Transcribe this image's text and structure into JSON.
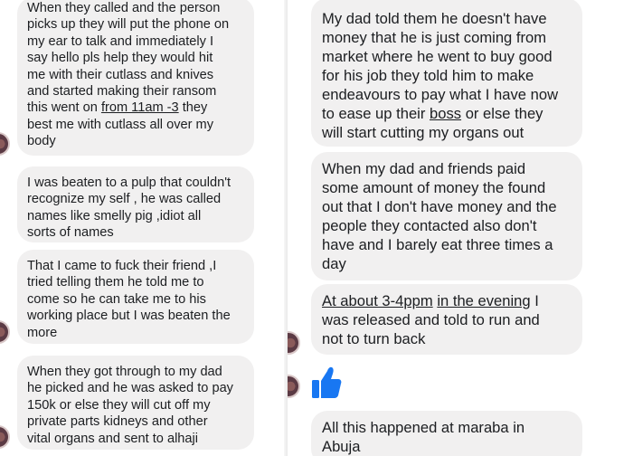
{
  "left_column": {
    "messages": [
      {
        "lines": [
          "When they called and the person",
          "picks up they will put the phone on",
          "my ear to talk and immediately I",
          "say hello pls help they would hit",
          "me with their cutlass and knives",
          "and started making their ransom"
        ],
        "line7_before": "this went on ",
        "line7_link": "from 11am -3",
        "line7_after": " they",
        "lines_end": [
          "best me with cutlass all over my",
          "body"
        ]
      },
      {
        "lines": [
          "I was beaten to a pulp that couldn't",
          "recognize my self , he was called",
          "names like smelly pig ,idiot all",
          "sorts of names"
        ]
      },
      {
        "lines": [
          "That I came to fuck their friend ,I",
          "tried telling them he told me to",
          "come so he can take me to his",
          "working place but I was beaten the",
          "more"
        ]
      },
      {
        "lines": [
          "When they got through to my dad",
          "he picked and he was asked to pay",
          "150k or else they will cut off my",
          "private parts kidneys and other",
          "vital organs and sent to alhaji"
        ]
      }
    ]
  },
  "right_column": {
    "messages": [
      {
        "lines": [
          "My dad told them he doesn't have",
          "money that he is just coming from",
          "market where he went to buy good",
          "for his job they told him to make",
          "endeavours to pay what I have now"
        ],
        "line6_before": "to ease up their ",
        "line6_link": "boss",
        "line6_after": " or else they",
        "lines_end": [
          "will start cutting my organs out"
        ]
      },
      {
        "lines": [
          "When my dad and friends paid",
          "some amount of money the found",
          "out that I don't have money and the",
          "people they contacted also don't",
          "have and I barely eat three times a",
          "day"
        ]
      },
      {
        "line1_link1": "At about 3-4ppm",
        "line1_space": " ",
        "line1_link2": "in the evening",
        "line1_after": " I",
        "lines": [
          "was released and told to run and",
          "not to turn back"
        ]
      },
      {
        "like_icon": "thumbs-up-icon",
        "like_color": "#1877f2"
      },
      {
        "lines": [
          "All this happened at maraba in",
          "Abuja"
        ]
      }
    ]
  },
  "colors": {
    "bubble_bg": "#f1f0f0",
    "text": "#1c1e21",
    "like": "#1877f2"
  }
}
